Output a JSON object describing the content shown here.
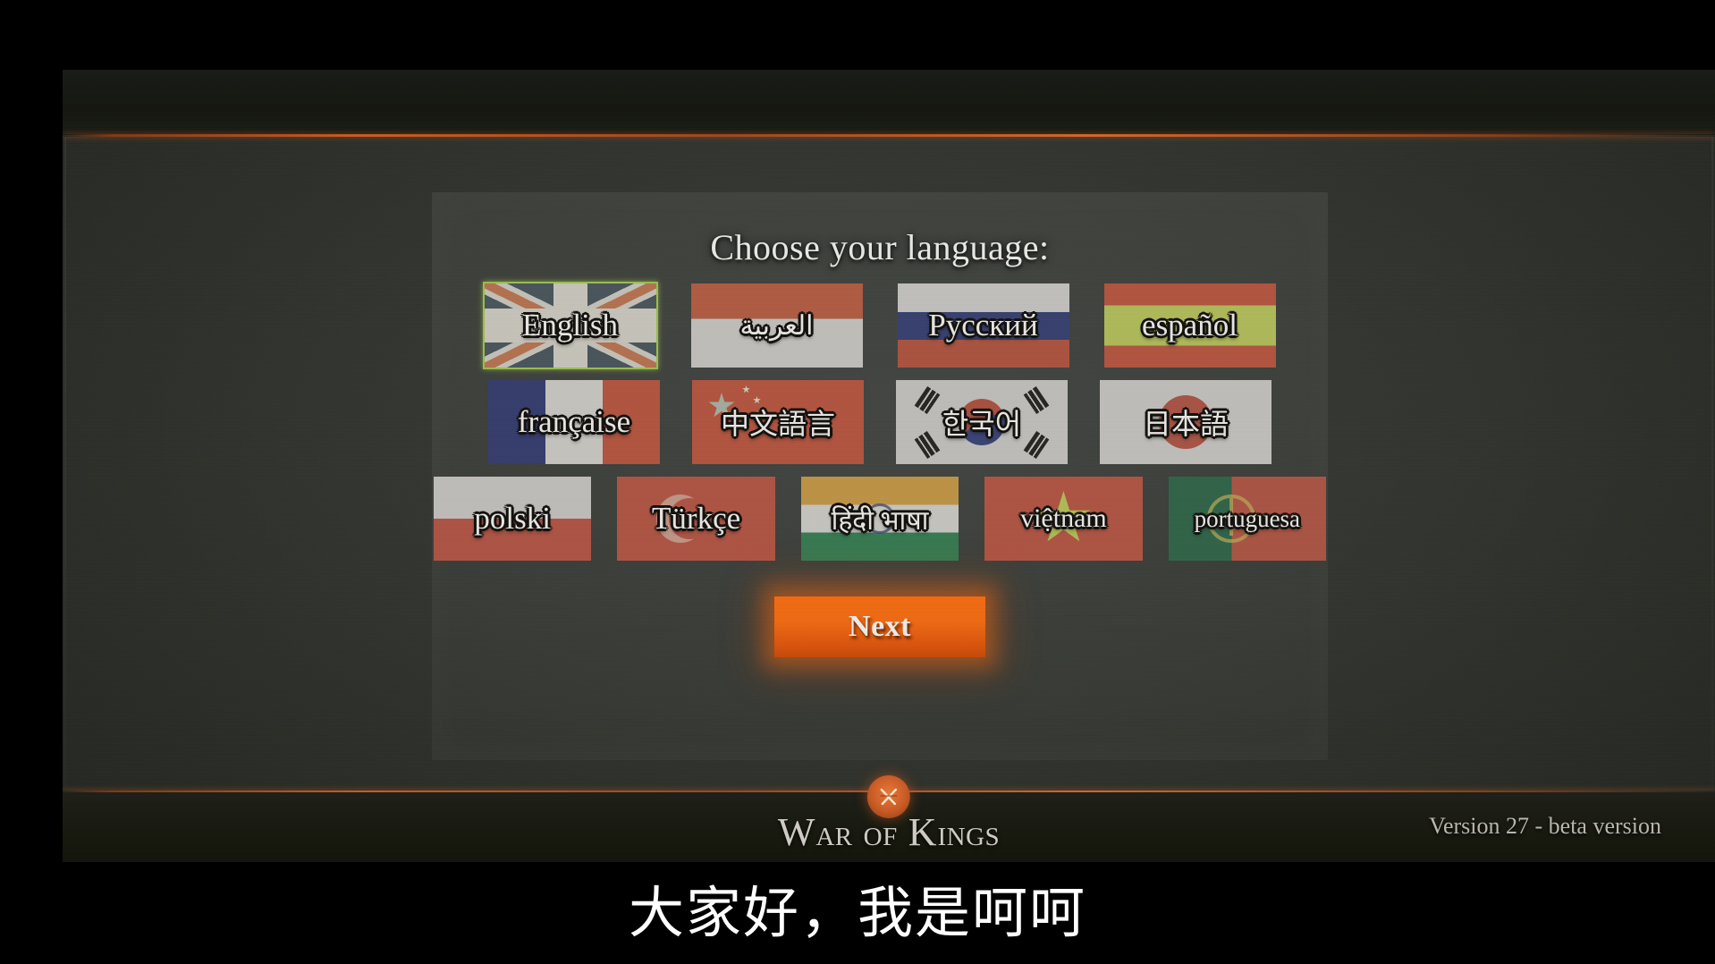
{
  "panel": {
    "title": "Choose your language:"
  },
  "languages": [
    [
      {
        "label": "English",
        "flag": "united-kingdom",
        "code": "en",
        "selected": true,
        "size": ""
      },
      {
        "label": "العربية",
        "flag": "arabic",
        "code": "ar",
        "selected": false,
        "size": "sm"
      },
      {
        "label": "Русский",
        "flag": "russia",
        "code": "ru",
        "selected": false,
        "size": ""
      },
      {
        "label": "español",
        "flag": "spain",
        "code": "es",
        "selected": false,
        "size": ""
      }
    ],
    [
      {
        "label": "française",
        "flag": "france",
        "code": "fr",
        "selected": false,
        "size": ""
      },
      {
        "label": "中文語言",
        "flag": "china",
        "code": "zh",
        "selected": false,
        "size": "cjk"
      },
      {
        "label": "한국어",
        "flag": "south-korea",
        "code": "ko",
        "selected": false,
        "size": "cjk"
      },
      {
        "label": "日本語",
        "flag": "japan",
        "code": "ja",
        "selected": false,
        "size": "cjk"
      }
    ],
    [
      {
        "label": "polski",
        "flag": "poland",
        "code": "pl",
        "selected": false,
        "size": ""
      },
      {
        "label": "Türkçe",
        "flag": "turkey",
        "code": "tr",
        "selected": false,
        "size": ""
      },
      {
        "label": "हिंदी भाषा",
        "flag": "india",
        "code": "hi",
        "selected": false,
        "size": "sm"
      },
      {
        "label": "việtnam",
        "flag": "vietnam",
        "code": "vi",
        "selected": false,
        "size": "sm"
      },
      {
        "label": "portuguesa",
        "flag": "portugal",
        "code": "pt",
        "selected": false,
        "size": "xs"
      }
    ]
  ],
  "next_button": {
    "label": "Next"
  },
  "footer": {
    "brand_part1": "W",
    "brand_part2": "AR",
    "brand_part3": "OF",
    "brand_part4": "K",
    "brand_part5": "INGS",
    "emblem_icon": "crossed-swords-icon",
    "version": "Version 27 - beta version"
  },
  "subtitle": {
    "text": "大家好，我是呵呵"
  },
  "colors": {
    "accent_orange": "#f06a12",
    "rule_orange": "#d65c1f",
    "selection_green": "#9ccb3b",
    "panel_bg": "#3a3d3a",
    "title_text": "#e7e7e3"
  }
}
